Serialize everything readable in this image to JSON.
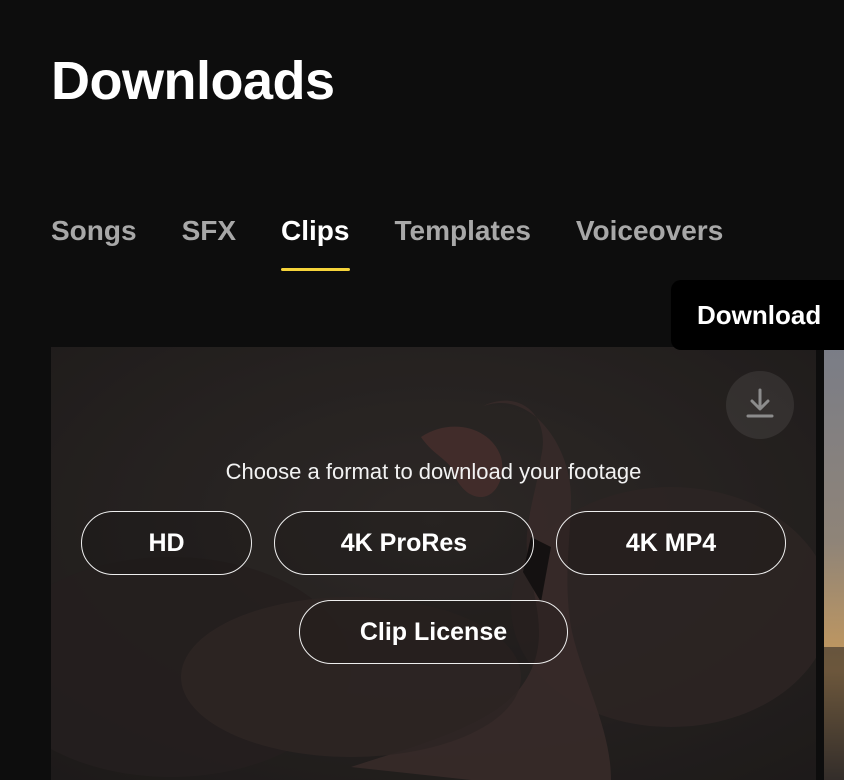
{
  "page": {
    "title": "Downloads"
  },
  "tabs": [
    {
      "label": "Songs",
      "active": false
    },
    {
      "label": "SFX",
      "active": false
    },
    {
      "label": "Clips",
      "active": true
    },
    {
      "label": "Templates",
      "active": false
    },
    {
      "label": "Voiceovers",
      "active": false
    }
  ],
  "tooltip": {
    "text": "Download"
  },
  "clip_card": {
    "prompt": "Choose a format to download your footage",
    "formats": [
      "HD",
      "4K ProRes",
      "4K MP4"
    ],
    "license_label": "Clip License",
    "download_icon": "download-icon"
  },
  "colors": {
    "background": "#0d0d0d",
    "active_tab_underline": "#f5d33a",
    "inactive_tab": "#a8a8a8",
    "tooltip_bg": "#000000"
  }
}
